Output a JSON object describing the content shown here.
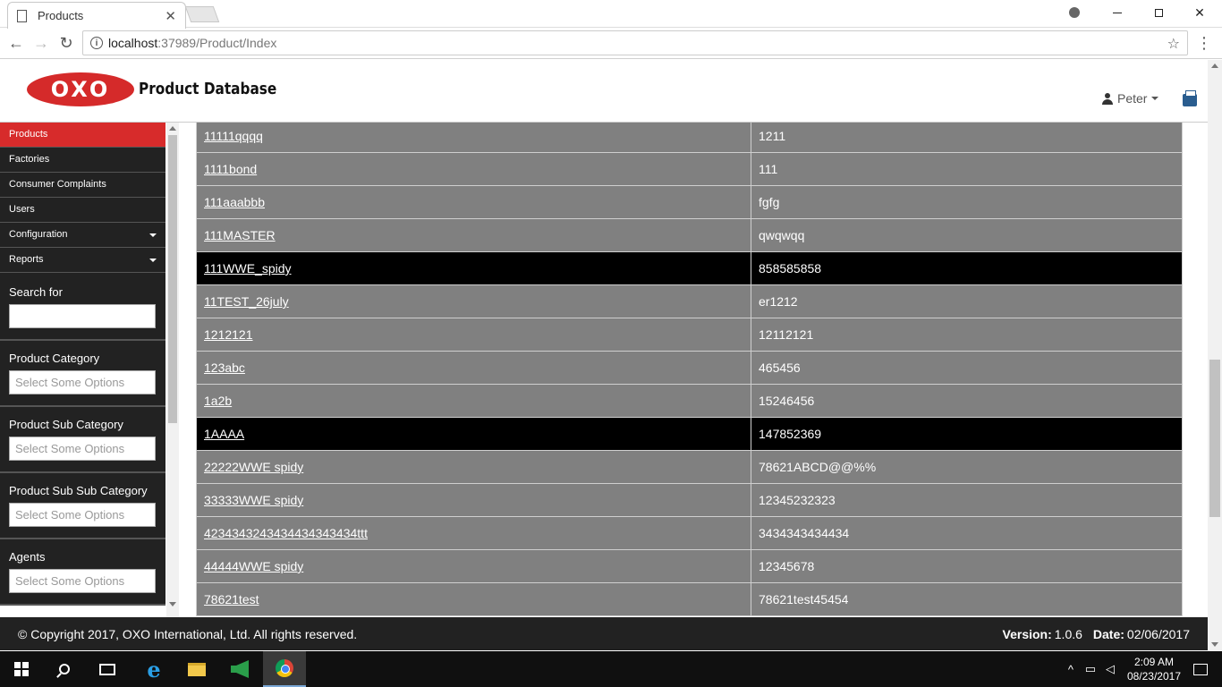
{
  "browser": {
    "tab_title": "Products",
    "tab_close": "✕",
    "url_host": "localhost",
    "url_path": ":37989/Product/Index"
  },
  "header": {
    "logo_text": "OXO",
    "app_title": "Product Database",
    "user_name": "Peter"
  },
  "sidebar": {
    "items": [
      {
        "label": "Products",
        "active": true
      },
      {
        "label": "Factories"
      },
      {
        "label": "Consumer Complaints"
      },
      {
        "label": "Users"
      },
      {
        "label": "Configuration",
        "dropdown": true
      },
      {
        "label": "Reports",
        "dropdown": true
      }
    ],
    "search_label": "Search for",
    "search_value": "",
    "filters": [
      {
        "label": "Product Category",
        "placeholder": "Select Some Options"
      },
      {
        "label": "Product Sub Category",
        "placeholder": "Select Some Options"
      },
      {
        "label": "Product Sub Sub Category",
        "placeholder": "Select Some Options"
      },
      {
        "label": "Agents",
        "placeholder": "Select Some Options"
      }
    ]
  },
  "table": {
    "rows": [
      {
        "name": "11111qqqq",
        "code": "1211"
      },
      {
        "name": "1111bond",
        "code": "111"
      },
      {
        "name": "111aaabbb",
        "code": "fgfg"
      },
      {
        "name": "111MASTER",
        "code": "qwqwqq"
      },
      {
        "name": "111WWE_spidy",
        "code": "858585858",
        "highlighted": true
      },
      {
        "name": "11TEST_26july",
        "code": "er1212"
      },
      {
        "name": "1212121",
        "code": "12112121"
      },
      {
        "name": "123abc",
        "code": "465456"
      },
      {
        "name": "1a2b",
        "code": "15246456"
      },
      {
        "name": "1AAAA",
        "code": "147852369",
        "highlighted": true
      },
      {
        "name": "22222WWE spidy",
        "code": "78621ABCD@@%%"
      },
      {
        "name": "33333WWE spidy",
        "code": "12345232323"
      },
      {
        "name": "4234343243434434343434ttt",
        "code": "3434343434434"
      },
      {
        "name": "44444WWE spidy",
        "code": "12345678"
      },
      {
        "name": "78621test",
        "code": "78621test45454"
      }
    ]
  },
  "footer": {
    "copyright": "© Copyright 2017, OXO International, Ltd. All rights reserved.",
    "version_label": "Version:",
    "version": "1.0.6",
    "date_label": "Date:",
    "date": "02/06/2017"
  },
  "taskbar": {
    "time": "2:09 AM",
    "date": "08/23/2017"
  },
  "colors": {
    "accent_red": "#d72b2b",
    "sidebar_bg": "#222222",
    "row_bg": "#808080",
    "row_highlight": "#000000"
  }
}
